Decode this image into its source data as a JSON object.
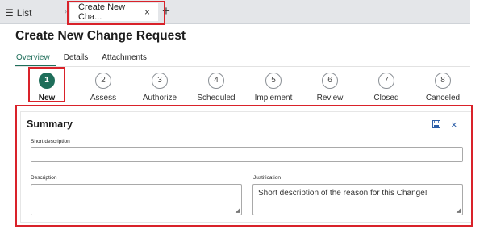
{
  "colors": {
    "accent": "#1f6e5a",
    "highlight": "#d9222a"
  },
  "tabbar": {
    "list_label": "List",
    "list_icon": "hamburger-icon",
    "active_tab_label": "Create New Cha...",
    "close_icon": "×",
    "new_tab_icon": "+"
  },
  "page": {
    "title": "Create New Change Request"
  },
  "subtabs": [
    "Overview",
    "Details",
    "Attachments"
  ],
  "steps": [
    {
      "number": "1",
      "label": "New",
      "active": true
    },
    {
      "number": "2",
      "label": "Assess"
    },
    {
      "number": "3",
      "label": "Authorize"
    },
    {
      "number": "4",
      "label": "Scheduled"
    },
    {
      "number": "5",
      "label": "Implement"
    },
    {
      "number": "6",
      "label": "Review"
    },
    {
      "number": "7",
      "label": "Closed"
    },
    {
      "number": "8",
      "label": "Canceled"
    }
  ],
  "summary": {
    "title": "Summary",
    "save_icon": "save-icon",
    "close_icon": "close-icon",
    "close_glyph": "×",
    "short_description_label": "Short description",
    "short_description_value": "",
    "description_label": "Description",
    "description_value": "",
    "justification_label": "Justification",
    "justification_value": "Short description of the reason for this Change!"
  }
}
